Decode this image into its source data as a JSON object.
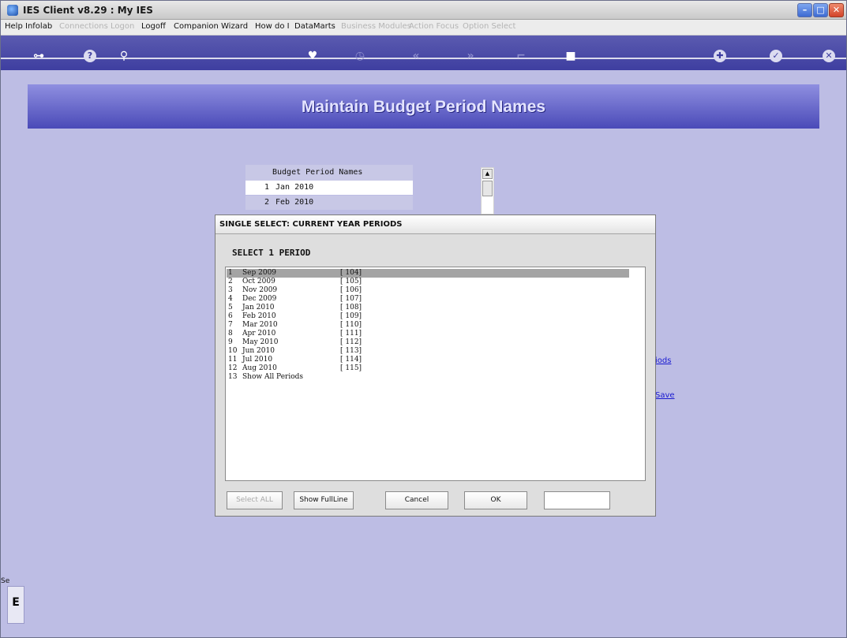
{
  "window": {
    "title": "IES Client v8.29 : My IES"
  },
  "menu": {
    "items": [
      {
        "label": "Help",
        "enabled": true
      },
      {
        "label": "Infolab",
        "enabled": true
      },
      {
        "label": "Connections",
        "enabled": false
      },
      {
        "label": "Logon",
        "enabled": false
      },
      {
        "label": "Logoff",
        "enabled": true
      },
      {
        "label": "Companion",
        "enabled": true
      },
      {
        "label": "Wizard",
        "enabled": true
      },
      {
        "label": "How do I",
        "enabled": true
      },
      {
        "label": "DataMarts",
        "enabled": true
      },
      {
        "label": "Business Modules",
        "enabled": false
      },
      {
        "label": "Action Focus",
        "enabled": false
      },
      {
        "label": "Option Select",
        "enabled": false
      }
    ]
  },
  "toolbar": {
    "icons": [
      "key-icon",
      "help-icon",
      "search-icon",
      "heart-icon",
      "clock-icon",
      "rewind-icon",
      "fast-forward-icon",
      "tag-icon",
      "square-icon",
      "target-icon",
      "check-icon",
      "close-icon"
    ]
  },
  "page": {
    "title": "Maintain Budget Period Names"
  },
  "budget_list": {
    "header": "Budget Period Names",
    "rows": [
      {
        "no": "1",
        "name": "Jan 2010"
      },
      {
        "no": "2",
        "name": "Feb 2010"
      }
    ]
  },
  "links": {
    "periods_fragment": "iods",
    "save_fragment": "Save"
  },
  "sidebar": {
    "label_fragment": "Se",
    "box_char": "E"
  },
  "dialog": {
    "title": "SINGLE SELECT: CURRENT YEAR PERIODS",
    "subtitle": "SELECT 1 PERIOD",
    "items": [
      {
        "no": "1",
        "name": "Sep 2009",
        "code": "[ 104]"
      },
      {
        "no": "2",
        "name": "Oct 2009",
        "code": "[ 105]"
      },
      {
        "no": "3",
        "name": "Nov 2009",
        "code": "[ 106]"
      },
      {
        "no": "4",
        "name": "Dec 2009",
        "code": "[ 107]"
      },
      {
        "no": "5",
        "name": "Jan 2010",
        "code": "[ 108]"
      },
      {
        "no": "6",
        "name": "Feb 2010",
        "code": "[ 109]"
      },
      {
        "no": "7",
        "name": "Mar 2010",
        "code": "[ 110]"
      },
      {
        "no": "8",
        "name": "Apr 2010",
        "code": "[ 111]"
      },
      {
        "no": "9",
        "name": "May 2010",
        "code": "[ 112]"
      },
      {
        "no": "10",
        "name": "Jun 2010",
        "code": "[ 113]"
      },
      {
        "no": "11",
        "name": "Jul 2010",
        "code": "[ 114]"
      },
      {
        "no": "12",
        "name": "Aug 2010",
        "code": "[ 115]"
      },
      {
        "no": "13",
        "name": "Show All Periods",
        "code": ""
      }
    ],
    "buttons": {
      "select_all": "Select ALL",
      "show_full_line": "Show FullLine",
      "cancel": "Cancel",
      "ok": "OK"
    },
    "input_value": ""
  }
}
